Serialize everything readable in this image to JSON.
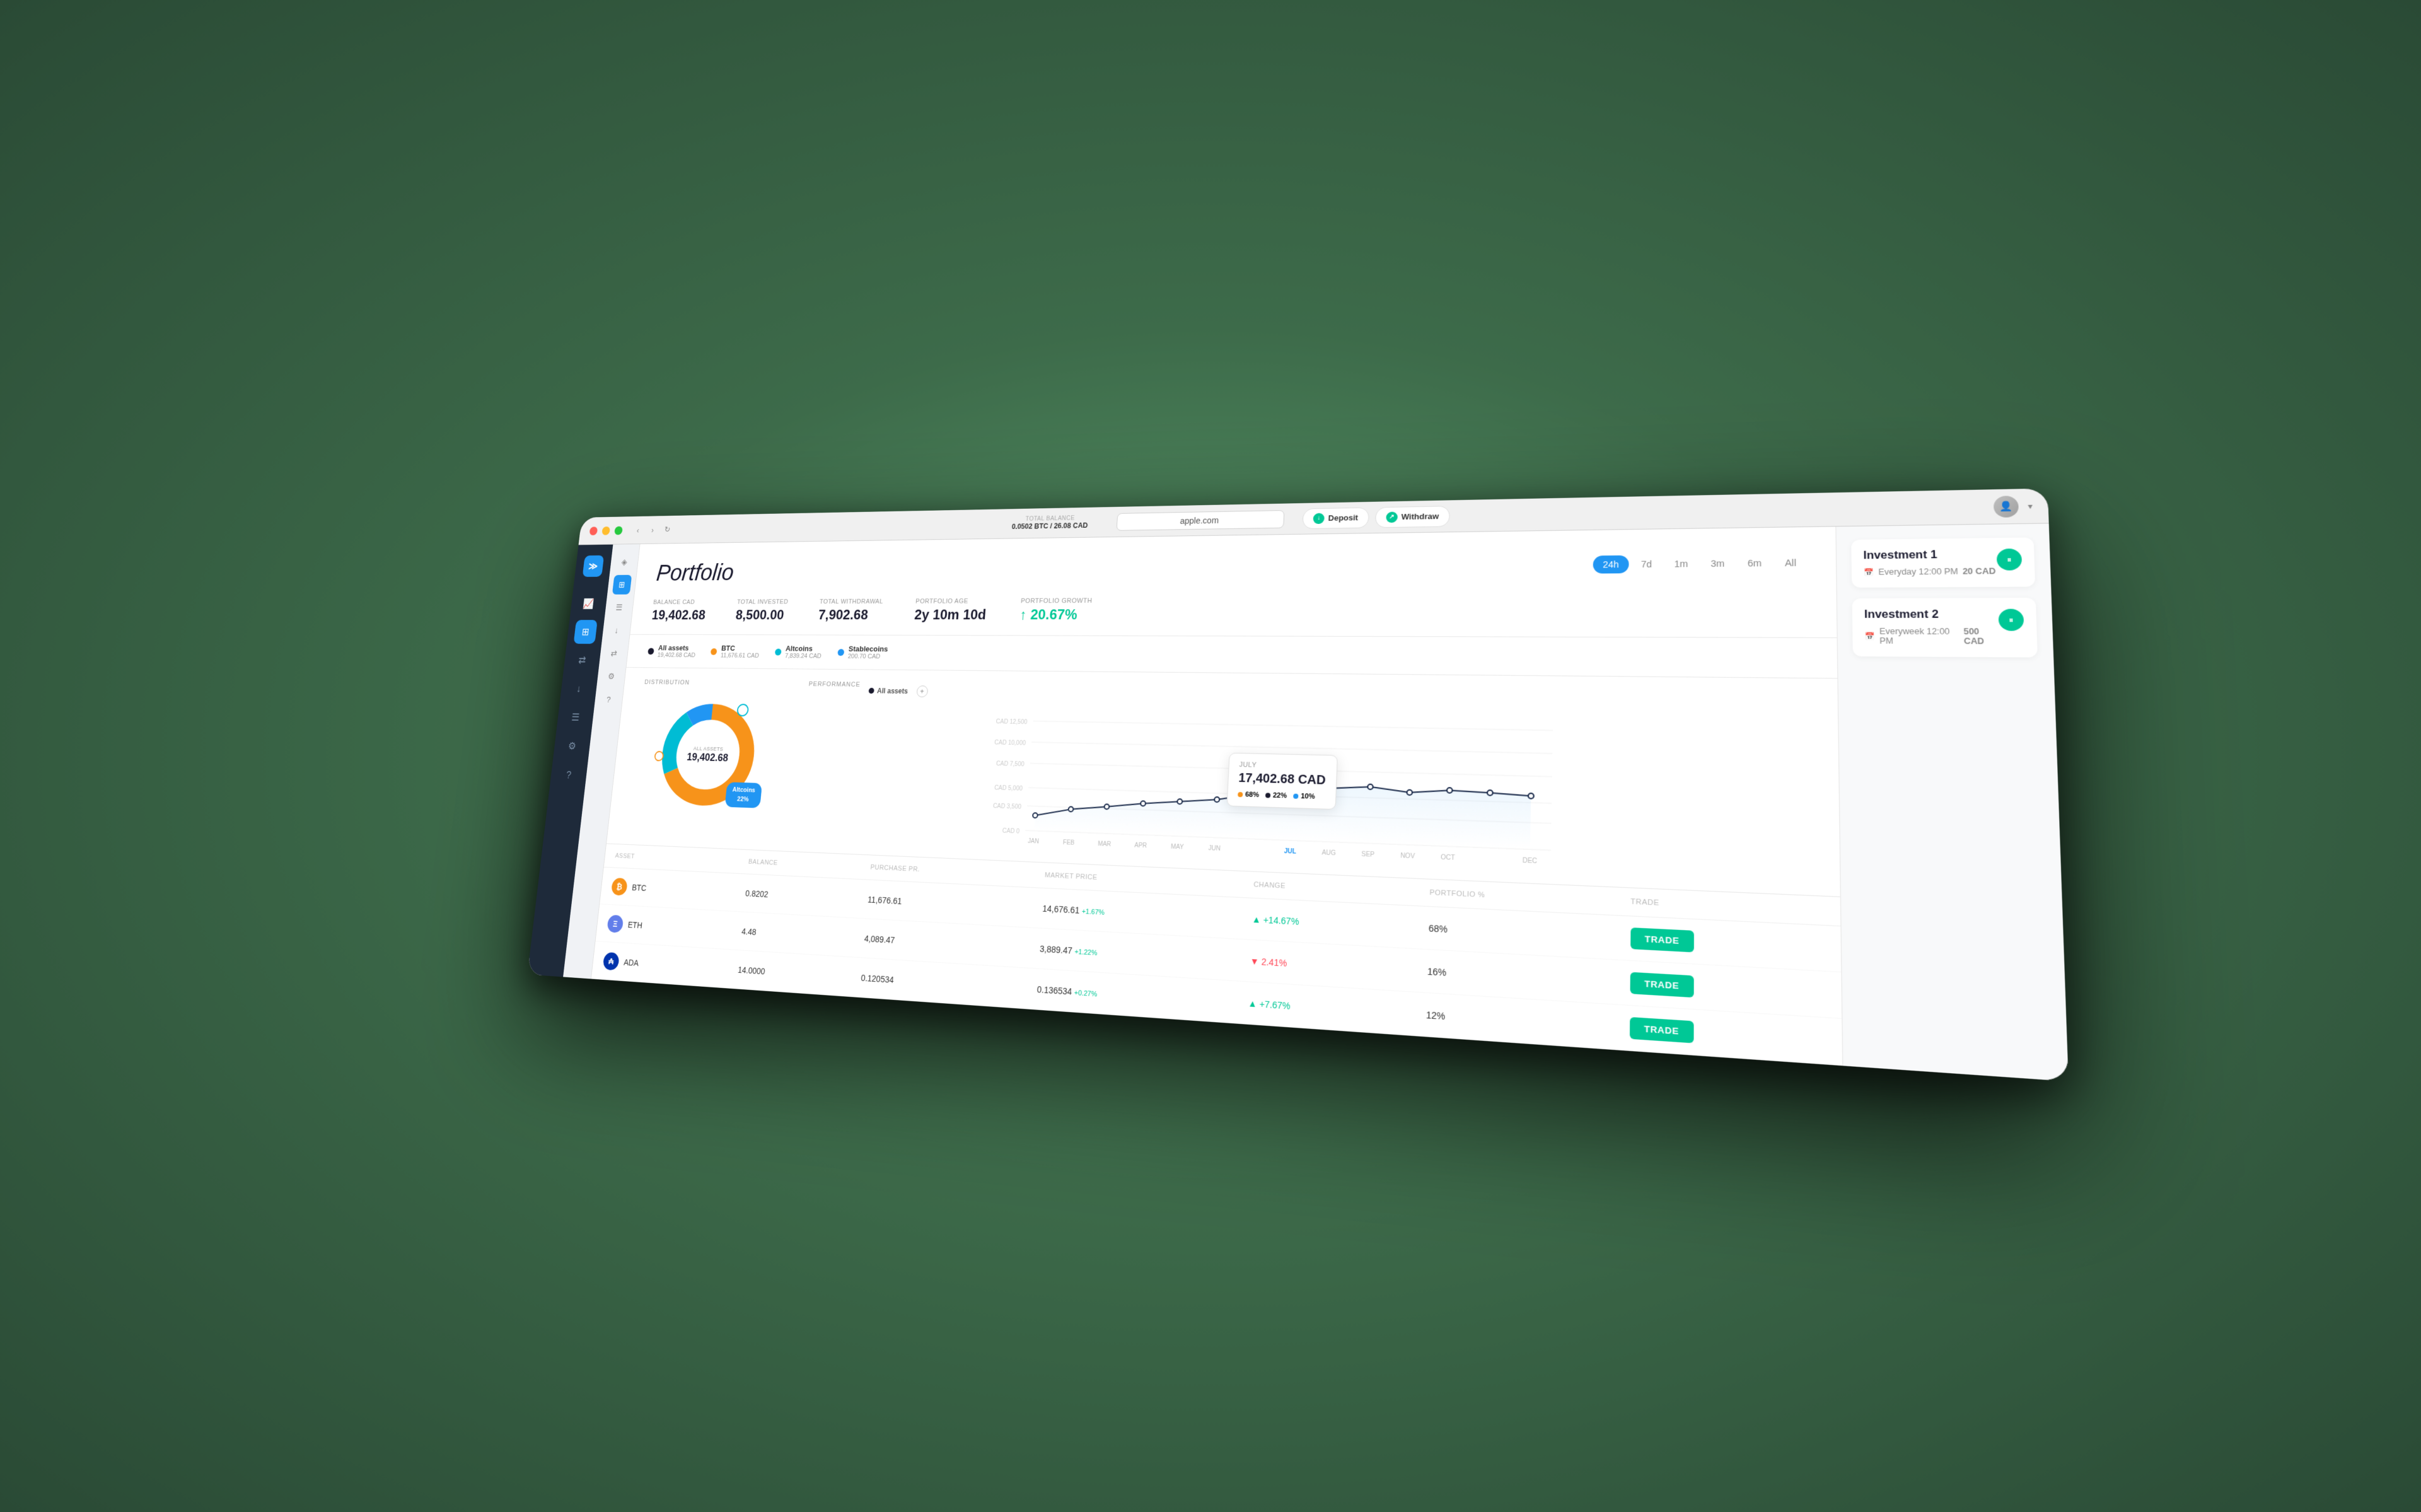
{
  "app": {
    "title": "apple.com",
    "logo": "≫",
    "balance_label": "TOTAL BALANCE",
    "balance_btc": "0.0502 BTC",
    "balance_cad": "26.08 CAD"
  },
  "header": {
    "deposit_label": "Deposit",
    "withdraw_label": "Withdraw"
  },
  "portfolio": {
    "title": "Portfolio",
    "time_filters": [
      "24h",
      "7d",
      "1m",
      "3m",
      "6m",
      "All"
    ],
    "active_filter": "24h",
    "stats": [
      {
        "label": "BALANCE CAD",
        "value": "19,402.68"
      },
      {
        "label": "TOTAL INVESTED",
        "value": "8,500.00"
      },
      {
        "label": "TOTAL WITHDRAWAL",
        "value": "7,902.68"
      },
      {
        "label": "PORTFOLIO AGE",
        "value": "2y 10m 10d"
      },
      {
        "label": "PORTFOLIO GROWTH",
        "value": "↑ 20.67%"
      }
    ]
  },
  "asset_filters": [
    {
      "name": "All assets",
      "value": "19,402.68 CAD",
      "color": "#1a1a2e"
    },
    {
      "name": "BTC",
      "value": "11,676.61 CAD",
      "color": "#f7931a"
    },
    {
      "name": "Altcoins",
      "value": "7,839.24 CAD",
      "color": "#00bcd4"
    },
    {
      "name": "Stablecoins",
      "value": "200.70 CAD",
      "color": "#2196F3"
    }
  ],
  "distribution": {
    "label": "DISTRIBUTION",
    "center_label": "ALL ASSETS",
    "center_value": "19,402.68",
    "bubble_label": "Altcoins\n22%"
  },
  "performance": {
    "label": "PERFORMANCE",
    "filter": "All assets",
    "tooltip": {
      "month": "JULY",
      "value": "17,402.68 CAD",
      "breakdown": [
        {
          "label": "68%",
          "color": "#f7931a"
        },
        {
          "label": "22%",
          "color": "#1a1a2e"
        },
        {
          "label": "10%",
          "color": "#2196F3"
        }
      ]
    },
    "y_labels": [
      "CAD 12,500",
      "CAD 10,000",
      "CAD 7,500",
      "CAD 5,000",
      "CAD 3,500",
      "CAD 0"
    ],
    "x_labels": [
      "JAN",
      "FEB",
      "MAR",
      "APR",
      "MAY",
      "JUN",
      "JUL",
      "AUG",
      "SEP",
      "NOV",
      "OCT",
      "DEC"
    ]
  },
  "assets_table": {
    "headers": [
      "ASSET",
      "BALANCE",
      "PURCHASE PR.",
      "MARKET PRICE",
      "CHANGE",
      "PORTFOLIO %",
      "TRADE"
    ],
    "rows": [
      {
        "symbol": "BTC",
        "icon_type": "btc",
        "balance": "0.8202",
        "purchase_price": "11,676.61",
        "market_price": "14,676.61",
        "price_change_pct": "+1.67%",
        "change": "+14.67%",
        "change_direction": "up",
        "portfolio_pct": "68%",
        "trade_label": "TRADE"
      },
      {
        "symbol": "ETH",
        "icon_type": "eth",
        "balance": "4.48",
        "purchase_price": "4,089.47",
        "market_price": "3,889.47",
        "price_change_pct": "+1.22%",
        "change": "2.41%",
        "change_direction": "down",
        "portfolio_pct": "16%",
        "trade_label": "TRADE"
      },
      {
        "symbol": "ADA",
        "icon_type": "ada",
        "balance": "14.0000",
        "purchase_price": "0.120534",
        "market_price": "0.136534",
        "price_change_pct": "+0.27%",
        "change": "+7.67%",
        "change_direction": "up",
        "portfolio_pct": "12%",
        "trade_label": "TRADE"
      }
    ]
  },
  "investments": [
    {
      "title": "Investment 1",
      "schedule": "Everyday 12:00 PM",
      "amount": "20 CAD"
    },
    {
      "title": "Investment 2",
      "schedule": "Everyweek 12:00 PM",
      "amount": "500 CAD"
    }
  ],
  "sidebar": {
    "icons": [
      "≫",
      "⊞",
      "⇄",
      "↓",
      "⊞",
      "◈",
      "?"
    ]
  }
}
